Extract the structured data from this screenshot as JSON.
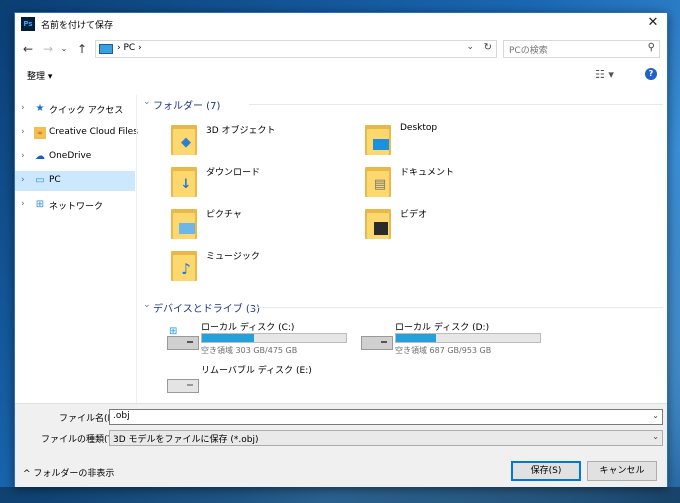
{
  "window": {
    "title": "名前を付けて保存",
    "app_icon_text": "Ps"
  },
  "nav": {
    "address": "PC",
    "search_placeholder": "PCの検索"
  },
  "toolbar": {
    "organize_label": "整理 ▾"
  },
  "navpane": {
    "items": [
      {
        "label": "クイック アクセス",
        "icon": "star-icon"
      },
      {
        "label": "Creative Cloud Files",
        "icon": "creative-cloud-folder-icon"
      },
      {
        "label": "OneDrive",
        "icon": "cloud-icon"
      },
      {
        "label": "PC",
        "icon": "computer-icon",
        "selected": true
      },
      {
        "label": "ネットワーク",
        "icon": "network-icon"
      }
    ]
  },
  "folders": {
    "header": "フォルダー (7)",
    "items": [
      {
        "label": "3D オブジェクト",
        "icon": "3d-objects-folder-icon"
      },
      {
        "label": "Desktop",
        "icon": "desktop-folder-icon"
      },
      {
        "label": "ダウンロード",
        "icon": "downloads-folder-icon"
      },
      {
        "label": "ドキュメント",
        "icon": "documents-folder-icon"
      },
      {
        "label": "ピクチャ",
        "icon": "pictures-folder-icon"
      },
      {
        "label": "ビデオ",
        "icon": "videos-folder-icon"
      },
      {
        "label": "ミュージック",
        "icon": "music-folder-icon"
      }
    ]
  },
  "drives": {
    "header": "デバイスとドライブ (3)",
    "items": [
      {
        "label": "ローカル ディスク (C:)",
        "free": "空き領域 303 GB/475 GB",
        "used_fraction": 0.36,
        "icon": "windows-drive-icon"
      },
      {
        "label": "ローカル ディスク (D:)",
        "free": "空き領域 687 GB/953 GB",
        "used_fraction": 0.28,
        "icon": "drive-icon"
      },
      {
        "label": "リムーバブル ディスク (E:)",
        "icon": "removable-drive-icon"
      }
    ]
  },
  "bottom": {
    "filename_label": "ファイル名(N):",
    "filename_value": ".obj",
    "filetype_label": "ファイルの種類(T):",
    "filetype_value": "3D モデルをファイルに保存 (*.obj)",
    "hide_folders_label": "^ フォルダーの非表示",
    "save_label": "保存(S)",
    "cancel_label": "キャンセル"
  },
  "colors": {
    "accent": "#0078d7",
    "drive_fill": "#26a0da",
    "selection": "#cce8ff",
    "header_text": "#1e3287"
  }
}
